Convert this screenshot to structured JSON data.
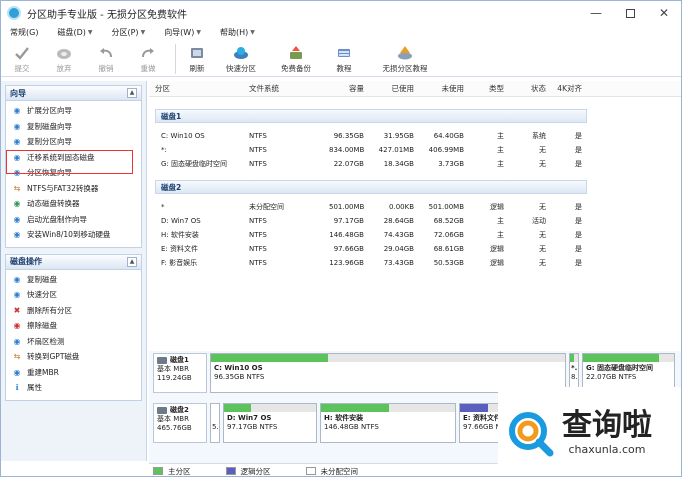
{
  "window": {
    "title": "分区助手专业版 - 无损分区免费软件"
  },
  "menu": [
    {
      "label": "常规(G)"
    },
    {
      "label": "磁盘(D)"
    },
    {
      "label": "分区(P)"
    },
    {
      "label": "向导(W)"
    },
    {
      "label": "帮助(H)"
    }
  ],
  "toolbar": [
    {
      "label": "提交",
      "icon": "check-icon",
      "disabled": true
    },
    {
      "label": "放弃",
      "icon": "discard-icon",
      "disabled": true
    },
    {
      "label": "撤销",
      "icon": "undo-icon",
      "disabled": true
    },
    {
      "label": "重做",
      "icon": "redo-icon",
      "disabled": true
    },
    {
      "label": "刷新",
      "icon": "refresh-icon",
      "disabled": false
    },
    {
      "label": "快速分区",
      "icon": "quick-partition-icon",
      "disabled": false
    },
    {
      "label": "免费备份",
      "icon": "backup-icon",
      "disabled": false
    },
    {
      "label": "教程",
      "icon": "tutorial-icon",
      "disabled": false
    },
    {
      "label": "无损分区教程",
      "icon": "lossless-tutorial-icon",
      "disabled": false
    }
  ],
  "left": {
    "wizard": {
      "title": "向导",
      "items": [
        "扩展分区向导",
        "复制磁盘向导",
        "复制分区向导",
        "迁移系统到固态磁盘",
        "分区恢复向导",
        "NTFS与FAT32转换器",
        "动态磁盘转换器",
        "启动光盘制作向导",
        "安装Win8/10到移动硬盘"
      ]
    },
    "diskops": {
      "title": "磁盘操作",
      "items": [
        "复制磁盘",
        "快速分区",
        "删除所有分区",
        "擦除磁盘",
        "坏扇区检测",
        "转换到GPT磁盘",
        "重建MBR",
        "属性"
      ]
    }
  },
  "table": {
    "headers": [
      "分区",
      "文件系统",
      "容量",
      "已使用",
      "未使用",
      "类型",
      "状态",
      "4K对齐"
    ],
    "disks": [
      {
        "name": "磁盘1",
        "rows": [
          [
            "C: Win10 OS",
            "NTFS",
            "96.35GB",
            "31.95GB",
            "64.40GB",
            "主",
            "系统",
            "是"
          ],
          [
            "*:",
            "NTFS",
            "834.00MB",
            "427.01MB",
            "406.99MB",
            "主",
            "无",
            "是"
          ],
          [
            "G: 固态硬盘临时空间",
            "NTFS",
            "22.07GB",
            "18.34GB",
            "3.73GB",
            "主",
            "无",
            "是"
          ]
        ]
      },
      {
        "name": "磁盘2",
        "rows": [
          [
            "*",
            "未分配空间",
            "501.00MB",
            "0.00KB",
            "501.00MB",
            "逻辑",
            "无",
            "是"
          ],
          [
            "D: Win7 OS",
            "NTFS",
            "97.17GB",
            "28.64GB",
            "68.52GB",
            "主",
            "活动",
            "是"
          ],
          [
            "H: 软件安装",
            "NTFS",
            "146.48GB",
            "74.43GB",
            "72.06GB",
            "主",
            "无",
            "是"
          ],
          [
            "E: 资料文件",
            "NTFS",
            "97.66GB",
            "29.04GB",
            "68.61GB",
            "逻辑",
            "无",
            "是"
          ],
          [
            "F: 影音娱乐",
            "NTFS",
            "123.96GB",
            "73.43GB",
            "50.53GB",
            "逻辑",
            "无",
            "是"
          ]
        ]
      }
    ]
  },
  "diskmap": [
    {
      "name": "磁盘1",
      "type": "基本 MBR",
      "size": "119.24GB",
      "parts": [
        {
          "title": "C: Win10 OS",
          "size": "96.35GB NTFS",
          "used": 0.33,
          "color": "#5cc35c"
        },
        {
          "title": "*.",
          "size": "8.",
          "used": 0.51,
          "color": "#5cc35c"
        },
        {
          "title": "G: 固态硬盘临时空间",
          "size": "22.07GB NTFS",
          "used": 0.83,
          "color": "#5cc35c"
        }
      ]
    },
    {
      "name": "磁盘2",
      "type": "基本 MBR",
      "size": "465.76GB",
      "parts": [
        {
          "title": "",
          "size": "5.",
          "used": 0.0,
          "color": "#ffffff"
        },
        {
          "title": "D: Win7 OS",
          "size": "97.17GB NTFS",
          "used": 0.29,
          "color": "#5cc35c"
        },
        {
          "title": "H: 软件安装",
          "size": "146.48GB NTFS",
          "used": 0.51,
          "color": "#5cc35c"
        },
        {
          "title": "E: 资料文件",
          "size": "97.66GB NTFS",
          "used": 0.3,
          "color": "#5a5fbf"
        }
      ]
    }
  ],
  "legend": [
    {
      "label": "主分区",
      "color": "#5cc35c"
    },
    {
      "label": "逻辑分区",
      "color": "#5a5fbf"
    },
    {
      "label": "未分配空间",
      "color": "#ffffff"
    }
  ],
  "watermark": {
    "cn": "查询啦",
    "en": "chaxunla.com"
  }
}
